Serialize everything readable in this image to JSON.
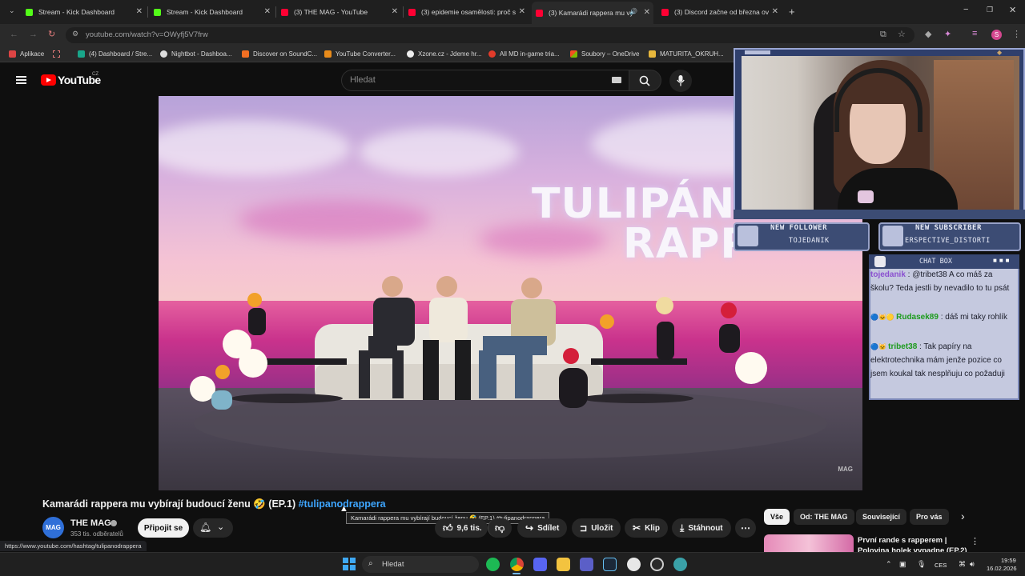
{
  "browser": {
    "tabs": [
      {
        "title": "Stream - Kick Dashboard",
        "favicon_color": "#53fc18"
      },
      {
        "title": "Stream - Kick Dashboard",
        "favicon_color": "#53fc18"
      },
      {
        "title": "(3) THE MAG - YouTube",
        "favicon_color": "#ff0033"
      },
      {
        "title": "(3) epidemie osamělosti: proč s",
        "favicon_color": "#ff0033"
      },
      {
        "title": "(3) Kamarádi rappera mu vy",
        "favicon_color": "#ff0033"
      },
      {
        "title": "(3) Discord začne od března ov",
        "favicon_color": "#ff0033"
      }
    ],
    "url": "youtube.com/watch?v=OWyfj5V7frw",
    "bookmarks": [
      {
        "label": "Aplikace",
        "icon": "apps-icon"
      },
      {
        "label": "(4) Dashboard / Stre...",
        "icon": "dashboard-icon"
      },
      {
        "label": "Nightbot - Dashboa...",
        "icon": "nightbot-icon"
      },
      {
        "label": "Discover on SoundC...",
        "icon": "soundcloud-icon"
      },
      {
        "label": "YouTube Converter...",
        "icon": "converter-icon"
      },
      {
        "label": "Xzone.cz - Jdeme hr...",
        "icon": "xzone-icon"
      },
      {
        "label": "All MD in-game tria...",
        "icon": "md-icon"
      },
      {
        "label": "Soubory – OneDrive",
        "icon": "onedrive-icon"
      },
      {
        "label": "MATURITA_OKRUH...",
        "icon": "folder-icon"
      }
    ]
  },
  "youtube": {
    "logo_text": "YouTube",
    "country": "CZ",
    "search_placeholder": "Hledat",
    "video": {
      "overlay_title_line1": "TULIPÁN",
      "overlay_title_line2": "RAPP",
      "watermark": "MAG",
      "title_main": "Kamarádi rappera mu vybírají budoucí ženu 🤣 (EP.1) ",
      "title_hashtag": "#tulipanodrappera",
      "tooltip": "Kamarádi rappera mu vybírají budoucí ženu 🤣 (EP.1) #tulipanodrappera"
    },
    "channel": {
      "avatar_text": "MAG",
      "name": "THE MAG",
      "subscribers": "353 tis. odběratelů",
      "subscribe_label": "Připojit se"
    },
    "actions": {
      "likes": "9,6 tis.",
      "share": "Sdílet",
      "save": "Uložit",
      "clip": "Klip",
      "download": "Stáhnout"
    },
    "chips": [
      {
        "label": "Vše",
        "selected": true
      },
      {
        "label": "Od: THE MAG",
        "selected": false
      },
      {
        "label": "Související",
        "selected": false
      },
      {
        "label": "Pro vás",
        "selected": false
      }
    ],
    "suggested": {
      "title_line1": "První rande s rapperem |",
      "title_line2": "Polovina holek vypadne (EP.2)"
    },
    "status_url": "https://www.youtube.com/hashtag/tulipanodrappera"
  },
  "stream_overlay": {
    "new_follower_title": "NEW FOLLOWER",
    "new_follower_name": "TOJEDANIK",
    "new_subscriber_title": "NEW SUBSCRIBER",
    "new_subscriber_name": "ERSPECTIVE_DISTORTI",
    "chat_title": "CHAT BOX",
    "chat": [
      {
        "user": "tojedanik",
        "user_color": "#8a4fd0",
        "text": " : @tribet38 A co máš za školu? Teda jestli by nevadilo to tu psát"
      },
      {
        "user": "Rudasek89",
        "user_color": "#1c9b1c",
        "text": " : dáš mi taky rohlík"
      },
      {
        "user": "tribet38",
        "user_color": "#1c9b1c",
        "text": " : Tak papíry na elektrotechnika mám jenže pozice co jsem koukal tak nesplňuju co požaduji"
      }
    ]
  },
  "taskbar": {
    "search_label": "Hledat",
    "language": "CES",
    "time": "19:59",
    "date": "16.02.2026"
  }
}
